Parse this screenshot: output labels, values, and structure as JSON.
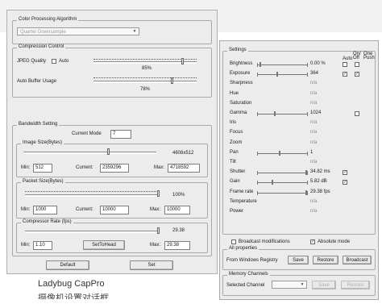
{
  "left_panel": {
    "color_processing": {
      "title": "Color Processing Algorithm",
      "selected": "Quarter Downsample"
    },
    "compression": {
      "title": "Compression Control",
      "jpeg_quality_label": "JPEG Quality",
      "auto_label": "Auto",
      "jpeg_value": "85%",
      "auto_buffer_label": "Auto Buffer Usage",
      "buffer_value": "78%"
    },
    "bandwidth": {
      "title": "Bandwidth Setting",
      "current_mode_label": "Current Mode",
      "current_mode_value": "7",
      "image_size": {
        "title": "Image Size(Bytes)",
        "right_value": "4608x512",
        "min_label": "Min:",
        "min_value": "512",
        "current_label": "Current:",
        "current_value": "2359296",
        "max_label": "Max:",
        "max_value": "4718592",
        "slider_fraction": 0.5
      },
      "packet_size": {
        "title": "Packet Size(Bytes)",
        "right_value": "100%",
        "min_label": "Min:",
        "min_value": "1000",
        "current_label": "Current:",
        "current_value": "10000",
        "max_label": "Max:",
        "max_value": "10000",
        "slider_fraction": 1.0
      }
    },
    "compressor_rate": {
      "title": "Compressor Rate (fps)",
      "right_value": "29.38",
      "min_label": "Min:",
      "min_value": "1.10",
      "set_to_head_label": "SetToHead",
      "max_label": "Max:",
      "max_value": "29.38"
    },
    "buttons": {
      "default_label": "Default",
      "set_label": "Set"
    }
  },
  "right_panel": {
    "settings_title": "Settings",
    "col_headers": {
      "auto": "Auto",
      "onoff": "On/ Off",
      "onepush": "One Push"
    },
    "rows": [
      {
        "name": "Brightness",
        "value": "0.00 %",
        "slider": true,
        "fraction": 0.05,
        "auto": false,
        "onoff": false
      },
      {
        "name": "Exposure",
        "value": "364",
        "slider": true,
        "fraction": 0.4,
        "auto": true,
        "onoff": true
      },
      {
        "name": "Sharpness",
        "value": "n/a",
        "slider": false
      },
      {
        "name": "Hue",
        "value": "n/a",
        "slider": false
      },
      {
        "name": "Saturation",
        "value": "n/a",
        "slider": false
      },
      {
        "name": "Gamma",
        "value": "1024",
        "slider": true,
        "fraction": 0.35,
        "onoff": false
      },
      {
        "name": "Iris",
        "value": "n/a",
        "slider": false
      },
      {
        "name": "Focus",
        "value": "n/a",
        "slider": false
      },
      {
        "name": "Zoom",
        "value": "n/a",
        "slider": false
      },
      {
        "name": "Pan",
        "value": "1",
        "slider": true,
        "fraction": 0.45
      },
      {
        "name": "Tilt",
        "value": "n/a",
        "slider": false
      },
      {
        "name": "Shutter",
        "value": "34.82 ms",
        "slider": true,
        "fraction": 1.0,
        "auto": true
      },
      {
        "name": "Gain",
        "value": "5.82 dB",
        "slider": true,
        "fraction": 0.3,
        "auto": true
      },
      {
        "name": "Frame rate",
        "value": "29.38 fps",
        "slider": true,
        "fraction": 1.0
      },
      {
        "name": "Temperature",
        "value": "n/a",
        "slider": false
      },
      {
        "name": "Power",
        "value": "n/a",
        "slider": false
      }
    ],
    "broadcast_mods_label": "Broadcast modifications",
    "absolute_mode_label": "Absolute mode",
    "absolute_mode_checked": true,
    "all_properties": {
      "title": "All properties",
      "from_label": "From Windows Registry",
      "save_label": "Save",
      "restore_label": "Restore",
      "broadcast_label": "Broadcast"
    },
    "memory_channels": {
      "title": "Memory Channels",
      "selected_label": "Selected Channel",
      "save_label": "Save",
      "restore_label": "Restore"
    }
  },
  "caption": {
    "line1": "Ladybug CapPro",
    "line2": "摄像机设置对话框"
  }
}
